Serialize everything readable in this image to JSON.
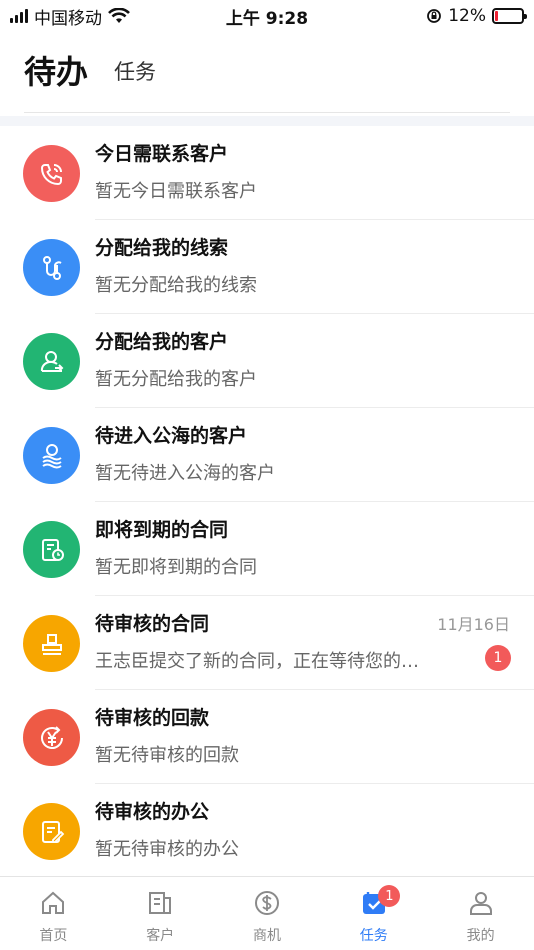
{
  "status_bar": {
    "carrier": "中国移动",
    "time": "上午 9:28",
    "battery": "12%"
  },
  "header": {
    "active_tab": "待办",
    "tab_task": "任务"
  },
  "items": [
    {
      "title": "今日需联系客户",
      "subtitle": "暂无今日需联系客户",
      "date": "",
      "badge": "",
      "color": "#f25f5c",
      "icon": "phone-icon"
    },
    {
      "title": "分配给我的线索",
      "subtitle": "暂无分配给我的线索",
      "date": "",
      "badge": "",
      "color": "#3a8ef6",
      "icon": "route-icon"
    },
    {
      "title": "分配给我的客户",
      "subtitle": "暂无分配给我的客户",
      "date": "",
      "badge": "",
      "color": "#22b573",
      "icon": "user-assign-icon"
    },
    {
      "title": "待进入公海的客户",
      "subtitle": "暂无待进入公海的客户",
      "date": "",
      "badge": "",
      "color": "#3a8ef6",
      "icon": "user-wave-icon"
    },
    {
      "title": "即将到期的合同",
      "subtitle": "暂无即将到期的合同",
      "date": "",
      "badge": "",
      "color": "#22b573",
      "icon": "contract-clock-icon"
    },
    {
      "title": "待审核的合同",
      "subtitle": "王志臣提交了新的合同，正在等待您的…",
      "date": "11月16日",
      "badge": "1",
      "color": "#f7a600",
      "icon": "stamp-icon"
    },
    {
      "title": "待审核的回款",
      "subtitle": "暂无待审核的回款",
      "date": "",
      "badge": "",
      "color": "#ee5a45",
      "icon": "yuan-icon"
    },
    {
      "title": "待审核的办公",
      "subtitle": "暂无待审核的办公",
      "date": "",
      "badge": "",
      "color": "#f7a600",
      "icon": "edit-doc-icon"
    }
  ],
  "tab_bar": [
    {
      "label": "首页",
      "icon": "home-icon",
      "active": false,
      "badge": ""
    },
    {
      "label": "客户",
      "icon": "customer-icon",
      "active": false,
      "badge": ""
    },
    {
      "label": "商机",
      "icon": "dollar-icon",
      "active": false,
      "badge": ""
    },
    {
      "label": "任务",
      "icon": "task-icon",
      "active": true,
      "badge": "1"
    },
    {
      "label": "我的",
      "icon": "profile-icon",
      "active": false,
      "badge": ""
    }
  ],
  "colors": {
    "accent": "#2f7cf6",
    "badge": "#f25a5a"
  }
}
